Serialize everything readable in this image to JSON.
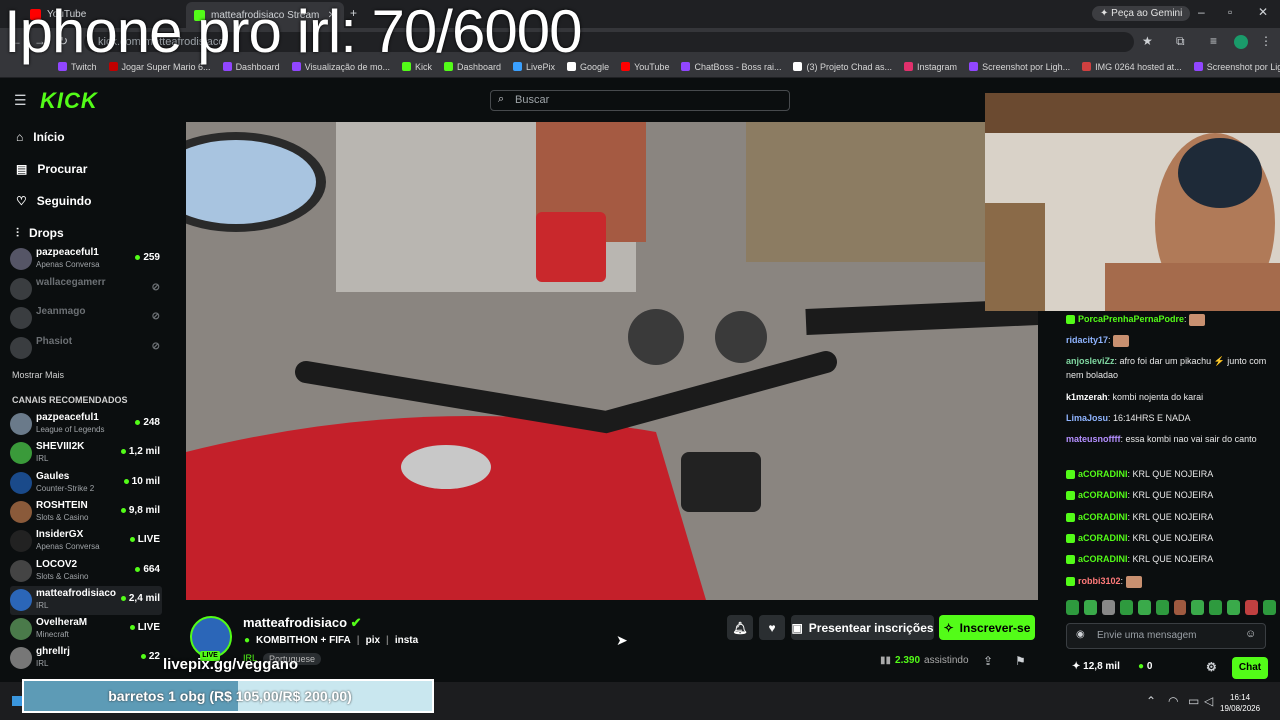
{
  "overlay_title": "Iphone pro irl: 70/6000",
  "browser": {
    "tabs": [
      {
        "label": "YouTube",
        "color": "#ff0000"
      },
      {
        "label": "matteafrodisiaco Stream",
        "color": "#53fc18"
      }
    ],
    "url": "kick.com/matteafrodisiaco",
    "gemini": "Peça ao Gemini",
    "bookmarks": [
      {
        "label": "Twitch",
        "color": "#9146ff"
      },
      {
        "label": "Jogar Super Mario 6...",
        "color": "#c00000"
      },
      {
        "label": "Dashboard",
        "color": "#9146ff"
      },
      {
        "label": "Visualização de mo...",
        "color": "#9146ff"
      },
      {
        "label": "Kick",
        "color": "#53fc18"
      },
      {
        "label": "Dashboard",
        "color": "#53fc18"
      },
      {
        "label": "LivePix",
        "color": "#3aa0ff"
      },
      {
        "label": "Google",
        "color": "#ffffff"
      },
      {
        "label": "YouTube",
        "color": "#ff0000"
      },
      {
        "label": "ChatBoss - Boss rai...",
        "color": "#9146ff"
      },
      {
        "label": "(3) Projeto Chad as...",
        "color": "#ffffff"
      },
      {
        "label": "Instagram",
        "color": "#e1306c"
      },
      {
        "label": "Screenshot por Ligh...",
        "color": "#9146ff"
      },
      {
        "label": "IMG 0264 hosted at...",
        "color": "#d04040"
      },
      {
        "label": "Screenshot por Ligh...",
        "color": "#9146ff"
      }
    ]
  },
  "kick": {
    "logo": "KICK",
    "search_placeholder": "Buscar",
    "nav": [
      "Início",
      "Procurar",
      "Seguindo",
      "Drops"
    ],
    "following": [
      {
        "name": "pazpeaceful1",
        "sub": "Apenas Conversa",
        "viewers": "259",
        "live": true
      },
      {
        "name": "wallacegamerr",
        "sub": "",
        "viewers": "",
        "live": false
      },
      {
        "name": "Jeanmago",
        "sub": "",
        "viewers": "",
        "live": false
      },
      {
        "name": "Phasiot",
        "sub": "",
        "viewers": "",
        "live": false
      }
    ],
    "show_more": "Mostrar Mais",
    "recommended_title": "CANAIS RECOMENDADOS",
    "recommended": [
      {
        "name": "pazpeaceful1",
        "sub": "League of Legends",
        "viewers": "248",
        "color": "#6a7a8a"
      },
      {
        "name": "SHEVIII2K",
        "sub": "IRL",
        "viewers": "1,2 mil",
        "color": "#3a9a3a"
      },
      {
        "name": "Gaules",
        "sub": "Counter-Strike 2",
        "viewers": "10 mil",
        "color": "#1a4a8a"
      },
      {
        "name": "ROSHTEIN",
        "sub": "Slots & Casino",
        "viewers": "9,8 mil",
        "color": "#8a5a3a"
      },
      {
        "name": "InsiderGX",
        "sub": "Apenas Conversa",
        "viewers": "LIVE",
        "color": "#222"
      },
      {
        "name": "LOCOV2",
        "sub": "Slots & Casino",
        "viewers": "664",
        "color": "#444"
      },
      {
        "name": "matteafrodisiaco",
        "sub": "IRL",
        "viewers": "2,4 mil",
        "color": "#2b66b8"
      },
      {
        "name": "OvelheraM",
        "sub": "Minecraft",
        "viewers": "LIVE",
        "color": "#4a7a4a"
      },
      {
        "name": "ghrellrj",
        "sub": "IRL",
        "viewers": "22",
        "color": "#777"
      }
    ]
  },
  "stream": {
    "channel": "matteafrodisiaco",
    "title": "KOMBITHON + FIFA",
    "links": [
      "pix",
      "insta"
    ],
    "category": "IRL",
    "language": "Portuguese",
    "live": "LIVE",
    "gift_label": "Presentear inscrições",
    "subscribe_label": "Inscrever-se",
    "viewers": "2.390",
    "viewers_label": "assistindo",
    "livepix_overlay": "livepix.gg/veggano"
  },
  "chat": {
    "messages": [
      {
        "user": "PorcaPrenhaPernaPodre",
        "text": "",
        "color": "#53fc18",
        "badge": true
      },
      {
        "user": "ridacity17",
        "text": "",
        "color": "#8fb4ff",
        "badge": false
      },
      {
        "user": "anjosleviZz",
        "text": "afro foi dar um pikachu ⚡ junto com nem boladao",
        "color": "#7fd6a0",
        "badge": false
      },
      {
        "user": "k1mzerah",
        "text": "kombi nojenta do karai",
        "color": "#ffffff",
        "badge": false
      },
      {
        "user": "LimaJosu",
        "text": "16:14HRS E NADA",
        "color": "#8fb4ff",
        "badge": false
      },
      {
        "user": "mateusnoffff",
        "text": "essa kombi nao vai sair do canto",
        "color": "#b48fff",
        "badge": false
      },
      {
        "user": "aCORADINI",
        "text": "KRL QUE NOJEIRA",
        "color": "#53fc18",
        "badge": true
      },
      {
        "user": "aCORADINI",
        "text": "KRL QUE NOJEIRA",
        "color": "#53fc18",
        "badge": true
      },
      {
        "user": "aCORADINI",
        "text": "KRL QUE NOJEIRA",
        "color": "#53fc18",
        "badge": true
      },
      {
        "user": "aCORADINI",
        "text": "KRL QUE NOJEIRA",
        "color": "#53fc18",
        "badge": true
      },
      {
        "user": "aCORADINI",
        "text": "KRL QUE NOJEIRA",
        "color": "#53fc18",
        "badge": true
      },
      {
        "user": "robbi3102",
        "text": "",
        "color": "#ff7a7a",
        "badge": true
      }
    ],
    "input_placeholder": "Envie uma mensagem",
    "balance": "12,8 mil",
    "points": "0",
    "chat_button": "Chat"
  },
  "goal": {
    "text": "barretos 1 obg (R$ 105,00/R$ 200,00)",
    "progress": 0.525
  },
  "clock": {
    "time": "16:14",
    "date": "19/08/2026"
  }
}
